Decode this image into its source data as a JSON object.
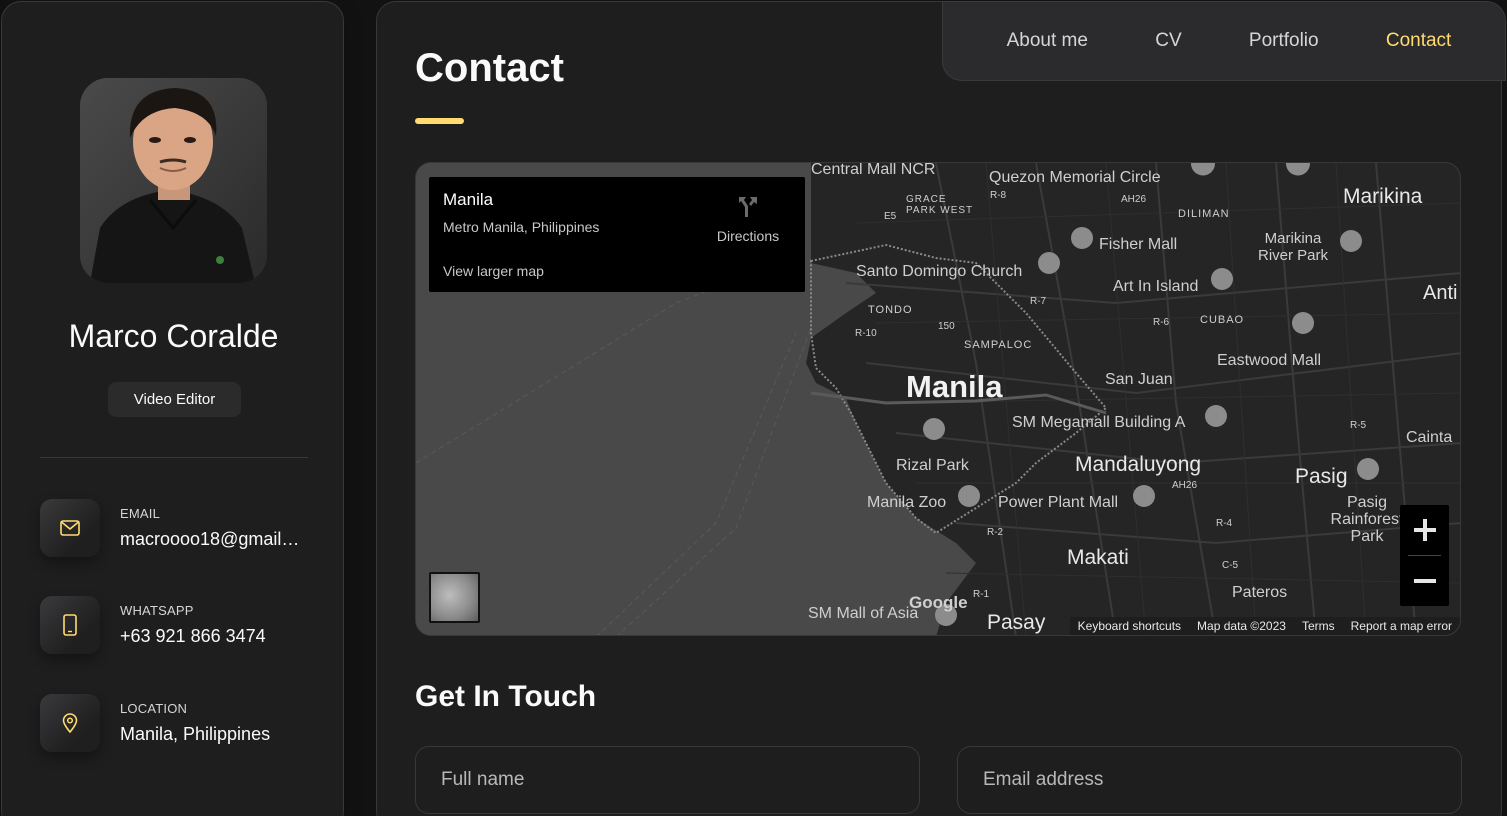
{
  "sidebar": {
    "name": "Marco Coralde",
    "title": "Video Editor",
    "contacts": [
      {
        "label": "EMAIL",
        "value": "macroooo18@gmail…",
        "icon": "mail-icon"
      },
      {
        "label": "WHATSAPP",
        "value": "+63 921 866 3474",
        "icon": "phone-icon"
      },
      {
        "label": "LOCATION",
        "value": "Manila, Philippines",
        "icon": "location-pin-icon"
      }
    ]
  },
  "nav": {
    "items": [
      "About me",
      "CV",
      "Portfolio",
      "Contact"
    ],
    "active": "Contact"
  },
  "page": {
    "title": "Contact"
  },
  "map": {
    "place_title": "Manila",
    "place_subtitle": "Metro Manila, Philippines",
    "directions_label": "Directions",
    "larger_map_label": "View larger map",
    "footer": [
      "Keyboard shortcuts",
      "Map data ©2023",
      "Terms",
      "Report a map error"
    ],
    "google_logo": "Google",
    "labels": [
      "Central Mall NCR",
      "Quezon Memorial Circle",
      "Marikina",
      "GRACE PARK WEST",
      "E5",
      "R-8",
      "AH26",
      "DILIMAN",
      "Fisher Mall",
      "Marikina River Park",
      "Santo Domingo Church",
      "Art In Island",
      "Anti",
      "TONDO",
      "R-7",
      "R-10",
      "150",
      "R-6",
      "CUBAO",
      "SAMPALOC",
      "Eastwood Mall",
      "Manila",
      "San Juan",
      "SM Megamall Building A",
      "R-5",
      "Cainta",
      "Rizal Park",
      "Mandaluyong",
      "AH26",
      "Pasig",
      "Manila Zoo",
      "Power Plant Mall",
      "Pasig Rainforest Park",
      "R-4",
      "R-2",
      "Makati",
      "C-5",
      "R-1",
      "Pateros",
      "SM Mall of Asia",
      "Pasay"
    ]
  },
  "form": {
    "section_title": "Get In Touch",
    "fullname_placeholder": "Full name",
    "email_placeholder": "Email address"
  },
  "colors": {
    "accent": "#ffdb70",
    "background": "#121212",
    "panel": "#1e1e1f"
  }
}
